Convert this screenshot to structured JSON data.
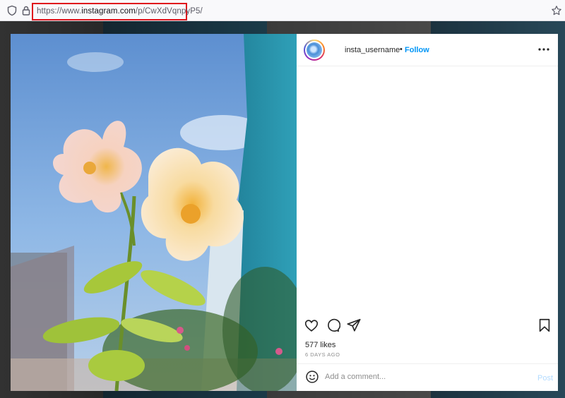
{
  "browser": {
    "url_prefix": "https://www.",
    "url_host": "instagram.com",
    "url_path": "/p/CwXdVqnpyP5/",
    "icons": [
      "shield-icon",
      "lock-icon",
      "bookmark-star-icon"
    ],
    "highlight_color": "#e0141c"
  },
  "post": {
    "username": "insta_username",
    "separator": "•",
    "follow_label": "Follow",
    "likes": "577 likes",
    "time_ago": "6 DAYS AGO",
    "comment_placeholder": "Add a comment...",
    "post_label": "Post",
    "action_icons": [
      "heart-icon",
      "comment-icon",
      "share-icon",
      "save-icon"
    ],
    "accent_color": "#0095f6"
  }
}
